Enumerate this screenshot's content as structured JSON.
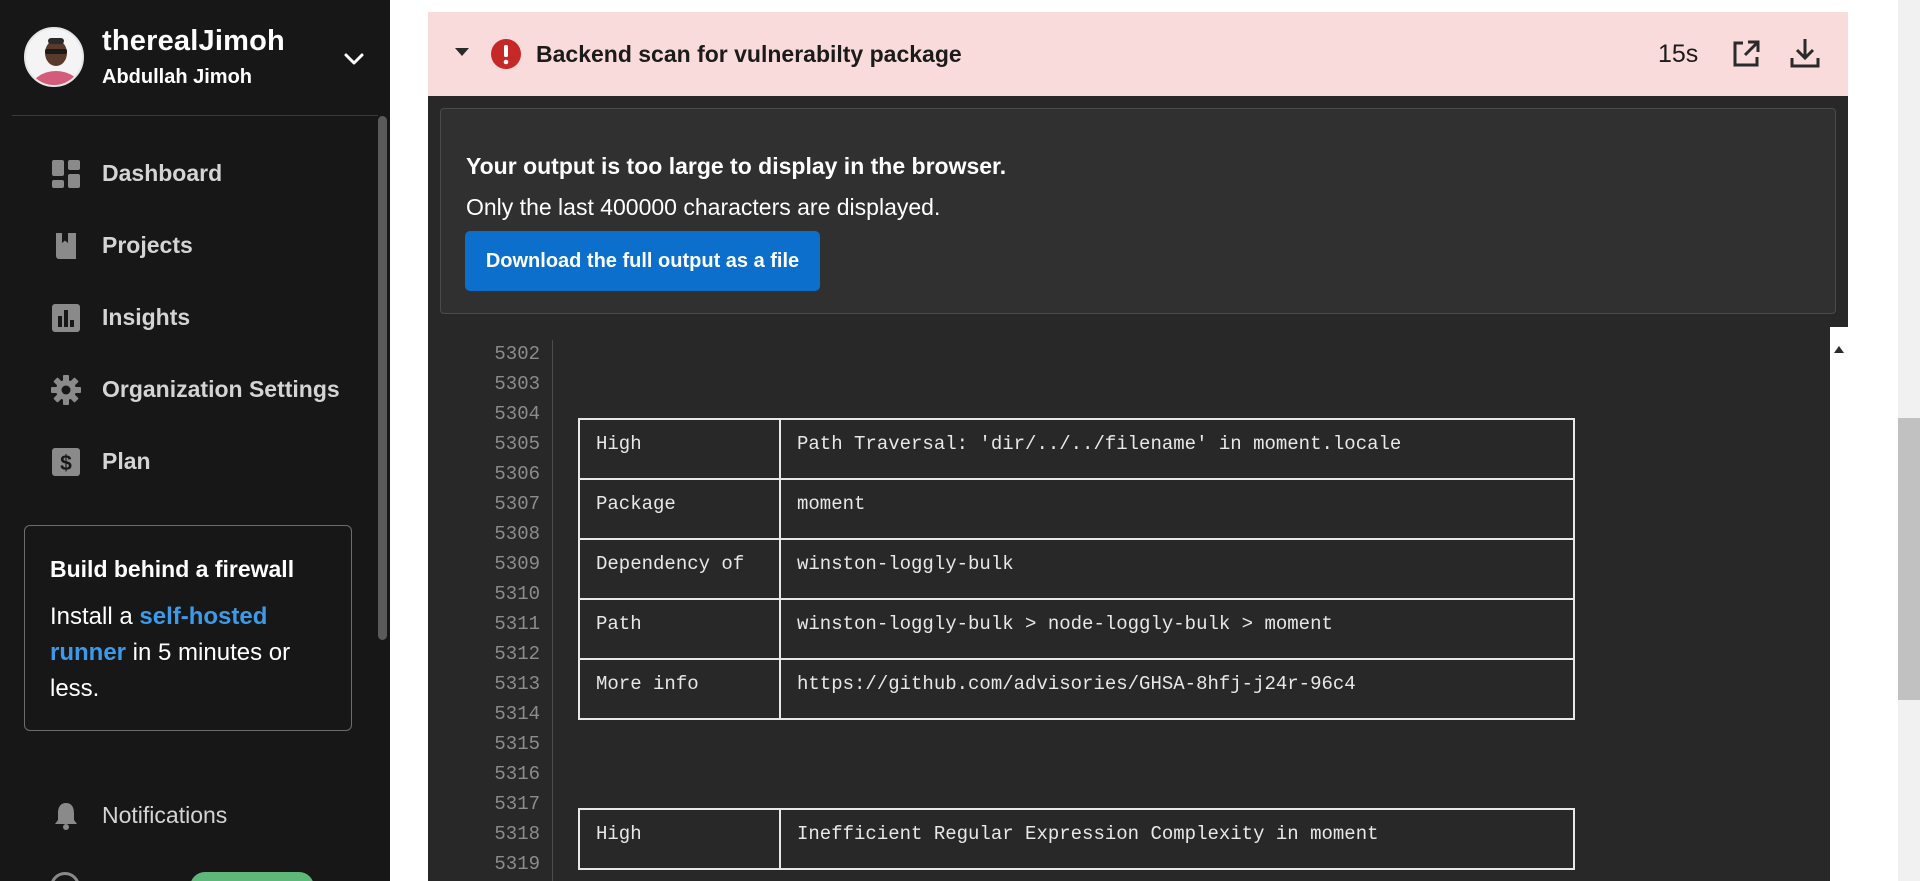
{
  "user": {
    "username": "therealJimoh",
    "full_name": "Abdullah Jimoh",
    "menu_icon": "chevron-down-icon"
  },
  "sidebar": {
    "items": [
      {
        "label": "Dashboard",
        "icon": "dashboard-icon"
      },
      {
        "label": "Projects",
        "icon": "book-icon"
      },
      {
        "label": "Insights",
        "icon": "bar-chart-icon"
      },
      {
        "label": "Organization Settings",
        "icon": "gear-icon"
      },
      {
        "label": "Plan",
        "icon": "dollar-icon"
      }
    ],
    "promo": {
      "title": "Build behind a firewall",
      "text_before": "Install a ",
      "link": "self-hosted runner",
      "text_after": " in 5 minutes or less."
    },
    "notifications": {
      "label": "Notifications",
      "icon": "bell-icon"
    }
  },
  "step": {
    "title": "Backend scan for vulnerabilty package",
    "duration": "15s",
    "status": "failed",
    "status_color": "#c62828",
    "header_color": "#fadbdc"
  },
  "output_notice": {
    "title": "Your output is too large to display in the browser.",
    "text": "Only the last 400000 characters are displayed.",
    "button": "Download the full output as a file",
    "button_color": "#0b6fcb"
  },
  "log": {
    "line_numbers": [
      "5302",
      "5303",
      "5304",
      "5305",
      "5306",
      "5307",
      "5308",
      "5309",
      "5310",
      "5311",
      "5312",
      "5313",
      "5314",
      "5315",
      "5316",
      "5317",
      "5318",
      "5319"
    ],
    "tables": [
      {
        "rows": [
          [
            "High",
            "Path Traversal: 'dir/../../filename' in moment.locale"
          ],
          [
            "Package",
            "moment"
          ],
          [
            "Dependency of",
            "winston-loggly-bulk"
          ],
          [
            "Path",
            "winston-loggly-bulk > node-loggly-bulk > moment"
          ],
          [
            "More info",
            "https://github.com/advisories/GHSA-8hfj-j24r-96c4"
          ]
        ]
      },
      {
        "rows": [
          [
            "High",
            "Inefficient Regular Expression Complexity in moment"
          ]
        ]
      }
    ]
  }
}
